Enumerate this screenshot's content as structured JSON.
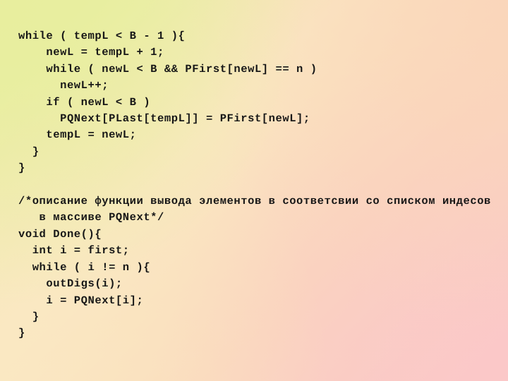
{
  "slide": {
    "kind": "code-listing-slide",
    "language": "C",
    "text_color": "#171717",
    "background": {
      "type": "diagonal-gradient",
      "top_left": "#e8eea2",
      "top_right": "#fad7bc",
      "bottom_left": "#fae8c2",
      "bottom_right": "#fbc8c8"
    }
  },
  "code": {
    "lines": [
      "while ( tempL < B - 1 ){",
      "    newL = tempL + 1;",
      "    while ( newL < B && PFirst[newL] == n )",
      "      newL++;",
      "    if ( newL < B )",
      "      PQNext[PLast[tempL]] = PFirst[newL];",
      "    tempL = newL;",
      "  }",
      "}",
      "",
      "/*описание функции вывода элементов в соответсвии со списком индесов",
      "   в массиве PQNext*/",
      "void Done(){",
      "  int i = first;",
      "  while ( i != n ){",
      "    outDigs(i);",
      "    i = PQNext[i];",
      "  }",
      "}"
    ]
  }
}
